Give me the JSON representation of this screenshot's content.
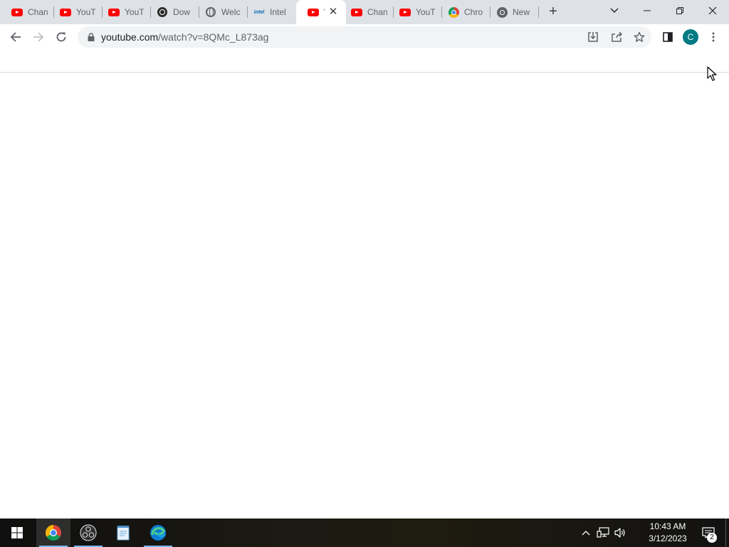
{
  "browser": {
    "tabs": [
      {
        "title": "Chan",
        "icon": "youtube-icon"
      },
      {
        "title": "YouT",
        "icon": "youtube-icon"
      },
      {
        "title": "YouT",
        "icon": "youtube-icon"
      },
      {
        "title": "Dow",
        "icon": "obs-icon"
      },
      {
        "title": "Welc",
        "icon": "globe-icon"
      },
      {
        "title": "Intel",
        "icon": "intel-icon"
      },
      {
        "title": "W",
        "icon": "youtube-icon",
        "active": true
      },
      {
        "title": "Chan",
        "icon": "youtube-icon"
      },
      {
        "title": "YouT",
        "icon": "youtube-icon"
      },
      {
        "title": "Chro",
        "icon": "chrome-icon"
      },
      {
        "title": "New",
        "icon": "chrome-gray-icon"
      }
    ],
    "new_tab_symbol": "+",
    "close_tab_symbol": "✕",
    "url_host": "youtube.com",
    "url_path": "/watch?v=8QMc_L873ag",
    "profile_initial": "C",
    "profile_color": "#007b83"
  },
  "taskbar": {
    "apps": [
      "windows-start-icon",
      "chrome-icon",
      "obs-icon",
      "notepad-icon",
      "edge-icon"
    ],
    "time": "10:43 AM",
    "date": "3/12/2023",
    "notification_count": "2"
  },
  "colors": {
    "tabstrip": "#dee1e6",
    "youtube_red": "#ff0000",
    "taskbar_highlight": "#76b9ed"
  }
}
